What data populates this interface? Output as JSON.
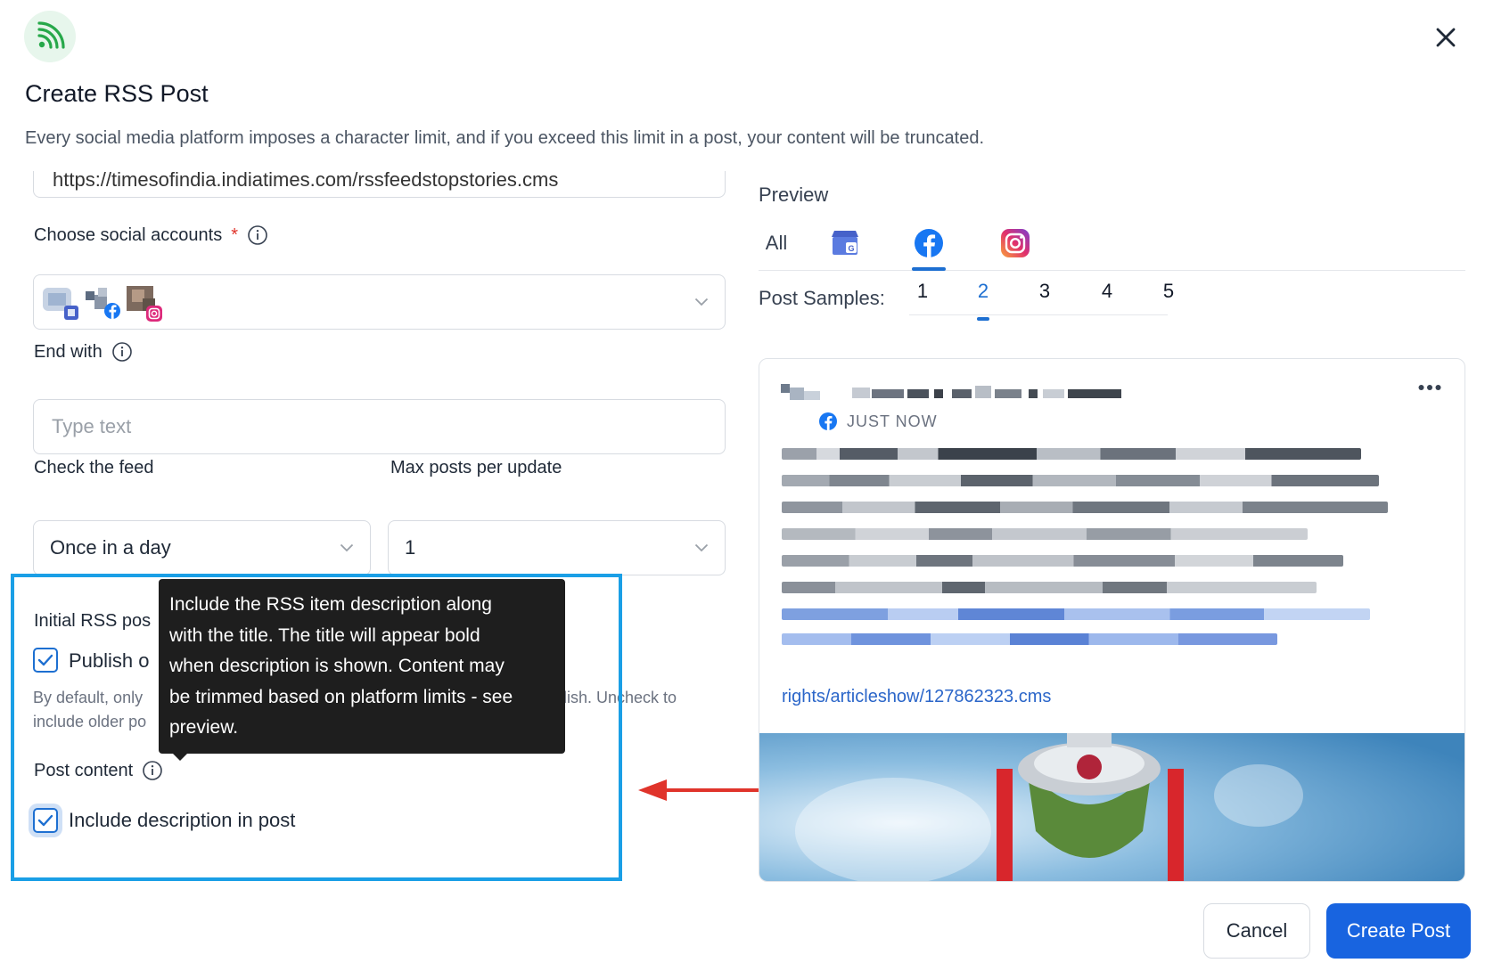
{
  "dialog": {
    "title": "Create RSS Post",
    "subtitle": "Every social media platform imposes a character limit, and if you exceed this limit in a post, your content will be truncated."
  },
  "form": {
    "feed_url": "https://timesofindia.indiatimes.com/rssfeedstopstories.cms",
    "social_accounts": {
      "label": "Choose social accounts",
      "required_mark": "*",
      "selected": [
        "google-business-account",
        "facebook-account",
        "instagram-account"
      ]
    },
    "end_with": {
      "label": "End with",
      "placeholder": "Type text",
      "value": ""
    },
    "check_feed": {
      "label": "Check the feed",
      "value": "Once in a day"
    },
    "max_posts": {
      "label": "Max posts per update",
      "value": "1"
    },
    "initial_rss": {
      "label_visible": "Initial RSS pos",
      "checkbox_label_visible": "Publish o",
      "checked": true,
      "help_line1_left": "By default, only",
      "help_line1_right": "lish. Uncheck to",
      "help_line2": "include older po"
    },
    "post_content": {
      "label": "Post content",
      "checkbox_label": "Include description in post",
      "checked": true
    }
  },
  "tooltip": {
    "lines": [
      "Include the RSS item description along",
      "with the title. The title will appear bold",
      "when description is shown. Content may",
      "be trimmed based on platform limits - see",
      "preview."
    ]
  },
  "preview": {
    "label": "Preview",
    "tabs": [
      {
        "label": "All",
        "icon": "text"
      },
      {
        "label": "",
        "icon": "google-business-icon"
      },
      {
        "label": "",
        "icon": "facebook-icon",
        "active": true
      },
      {
        "label": "",
        "icon": "instagram-icon"
      }
    ],
    "samples_label": "Post Samples:",
    "samples": [
      "1",
      "2",
      "3",
      "4",
      "5"
    ],
    "active_sample": "2",
    "post": {
      "time": "JUST NOW",
      "link_fragment": "rights/articleshow/127862323.cms"
    }
  },
  "footer": {
    "cancel": "Cancel",
    "create": "Create Post"
  },
  "colors": {
    "accent": "#1864e0",
    "highlight_border": "#1a9fe6",
    "annotation_arrow": "#e0342b",
    "rss_green": "#27a84a"
  }
}
